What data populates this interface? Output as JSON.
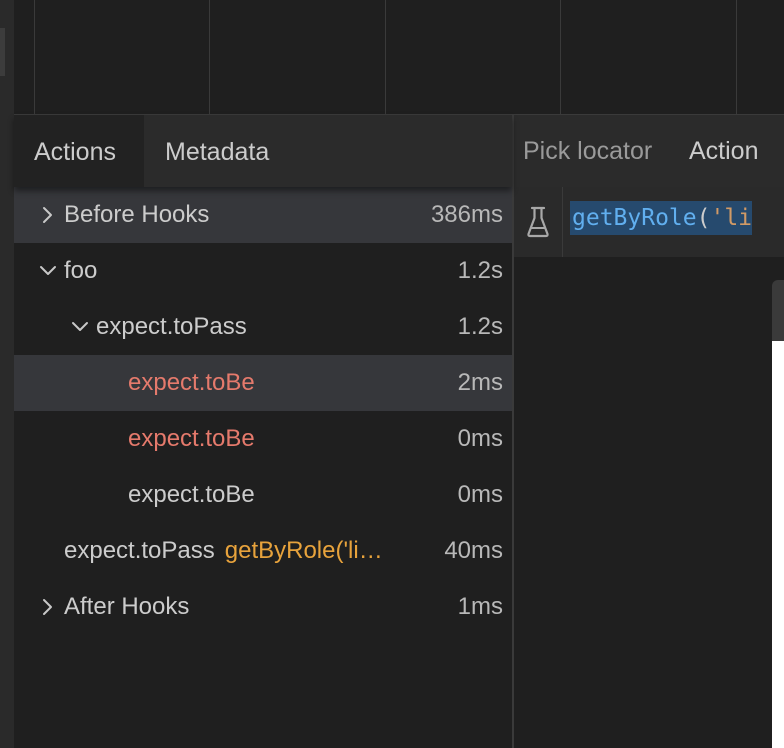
{
  "tabs_left": {
    "actions": "Actions",
    "metadata": "Metadata"
  },
  "tabs_right": {
    "pick_locator": "Pick locator",
    "action": "Action"
  },
  "locator": {
    "fn": "getByRole",
    "open": "(",
    "str": "'li"
  },
  "actions": [
    {
      "title": "Before Hooks",
      "duration": "386ms",
      "expander": "collapsed",
      "depth": 0,
      "highlighted": true,
      "error": false
    },
    {
      "title": "foo",
      "duration": "1.2s",
      "expander": "expanded",
      "depth": 0,
      "highlighted": false,
      "error": false
    },
    {
      "title": "expect.toPass",
      "duration": "1.2s",
      "expander": "expanded",
      "depth": 1,
      "highlighted": false,
      "error": false
    },
    {
      "title": "expect.toBe",
      "duration": "2ms",
      "expander": "none",
      "depth": 2,
      "highlighted": true,
      "error": true
    },
    {
      "title": "expect.toBe",
      "duration": "0ms",
      "expander": "none",
      "depth": 2,
      "highlighted": false,
      "error": true
    },
    {
      "title": "expect.toBe",
      "duration": "0ms",
      "expander": "none",
      "depth": 2,
      "highlighted": false,
      "error": false
    },
    {
      "title": "expect.toPass",
      "selector": "getByRole('li…",
      "duration": "40ms",
      "expander": "none",
      "depth": 0,
      "highlighted": false,
      "error": false
    },
    {
      "title": "After Hooks",
      "duration": "1ms",
      "expander": "collapsed",
      "depth": 0,
      "highlighted": false,
      "error": false
    }
  ],
  "colors": {
    "error": "#e57a6c",
    "selector": "#e8a33c",
    "highlight": "#36373b",
    "code_fn": "#61afef",
    "code_str": "#d19a66"
  },
  "icons": {
    "expander": "chevron-icon",
    "locator": "flask-icon"
  }
}
